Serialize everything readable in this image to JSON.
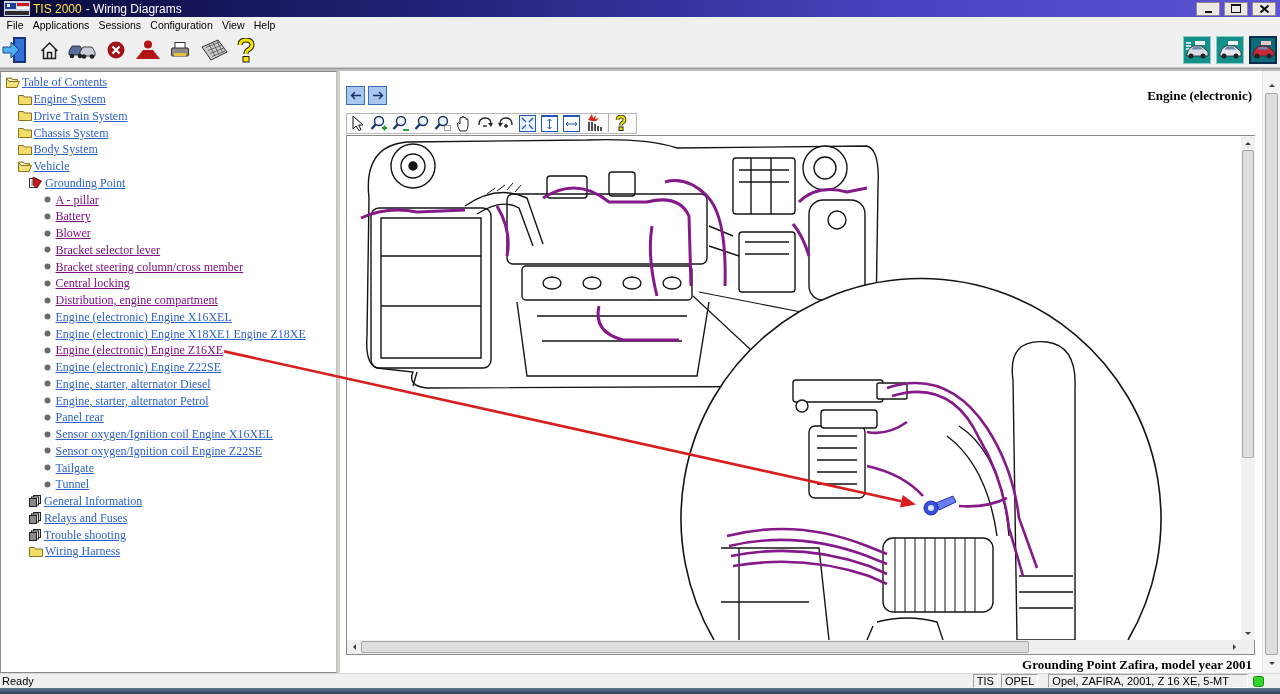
{
  "window": {
    "app_name": "TIS 2000",
    "title": "- Wiring Diagrams"
  },
  "menu": [
    "File",
    "Applications",
    "Sessions",
    "Configuration",
    "View",
    "Help"
  ],
  "view_buttons": [
    {
      "selected": false
    },
    {
      "selected": false
    },
    {
      "selected": true
    }
  ],
  "tree": [
    {
      "label": "Table of Contents",
      "kind": "folder",
      "expanded": true,
      "visited": false,
      "children": [
        {
          "label": "Engine System",
          "kind": "folder",
          "expanded": false,
          "visited": false
        },
        {
          "label": "Drive Train System",
          "kind": "folder",
          "expanded": false,
          "visited": false
        },
        {
          "label": "Chassis System",
          "kind": "folder",
          "expanded": false,
          "visited": false
        },
        {
          "label": "Body System",
          "kind": "folder",
          "expanded": false,
          "visited": false
        },
        {
          "label": "Vehicle",
          "kind": "folder",
          "expanded": true,
          "visited": false,
          "children": [
            {
              "label": "Grounding Point",
              "kind": "book",
              "expanded": true,
              "visited": false,
              "children": [
                {
                  "label": "A - pillar",
                  "kind": "page",
                  "visited": true,
                  "annotated": false
                },
                {
                  "label": "Battery",
                  "kind": "page",
                  "visited": true,
                  "annotated": false
                },
                {
                  "label": "Blower",
                  "kind": "page",
                  "visited": true,
                  "annotated": false
                },
                {
                  "label": "Bracket selector lever",
                  "kind": "page",
                  "visited": true,
                  "annotated": false
                },
                {
                  "label": "Bracket steering column/cross member",
                  "kind": "page",
                  "visited": true,
                  "annotated": false
                },
                {
                  "label": "Central locking",
                  "kind": "page",
                  "visited": true,
                  "annotated": false
                },
                {
                  "label": "Distribution, engine compartment",
                  "kind": "page",
                  "visited": true,
                  "annotated": false
                },
                {
                  "label": "Engine (electronic) Engine X16XEL",
                  "kind": "page",
                  "visited": false,
                  "annotated": false
                },
                {
                  "label": "Engine (electronic) Engine X18XE1 Engine Z18XE",
                  "kind": "page",
                  "visited": false,
                  "annotated": false
                },
                {
                  "label": "Engine (electronic) Engine Z16XE",
                  "kind": "page",
                  "visited": true,
                  "annotated": true
                },
                {
                  "label": "Engine (electronic) Engine Z22SE",
                  "kind": "page",
                  "visited": false,
                  "annotated": false
                },
                {
                  "label": "Engine, starter, alternator Diesel",
                  "kind": "page",
                  "visited": false,
                  "annotated": false
                },
                {
                  "label": "Engine, starter, alternator Petrol",
                  "kind": "page",
                  "visited": false,
                  "annotated": false
                },
                {
                  "label": "Panel rear",
                  "kind": "page",
                  "visited": false,
                  "annotated": false
                },
                {
                  "label": "Sensor oxygen/Ignition coil Engine X16XEL",
                  "kind": "page",
                  "visited": false,
                  "annotated": false
                },
                {
                  "label": "Sensor oxygen/Ignition coil Engine Z22SE",
                  "kind": "page",
                  "visited": false,
                  "annotated": false
                },
                {
                  "label": "Tailgate",
                  "kind": "page",
                  "visited": false,
                  "annotated": false
                },
                {
                  "label": "Tunnel",
                  "kind": "page",
                  "visited": false,
                  "annotated": false
                }
              ]
            },
            {
              "label": "General Information",
              "kind": "book",
              "expanded": false,
              "visited": false
            },
            {
              "label": "Relays and Fuses",
              "kind": "book",
              "expanded": false,
              "visited": false
            },
            {
              "label": "Trouble shooting",
              "kind": "book",
              "expanded": false,
              "visited": false
            },
            {
              "label": "Wiring Harness",
              "kind": "folder",
              "expanded": false,
              "visited": false
            }
          ]
        }
      ]
    }
  ],
  "document": {
    "heading": "Engine (electronic)",
    "caption": "Grounding Point Zafira, model year 2001"
  },
  "status_bar": {
    "text": "Ready",
    "panels": [
      "TIS",
      "OPEL",
      "Opel, ZAFIRA, 2001, Z 16 XE, 5-MT"
    ]
  }
}
